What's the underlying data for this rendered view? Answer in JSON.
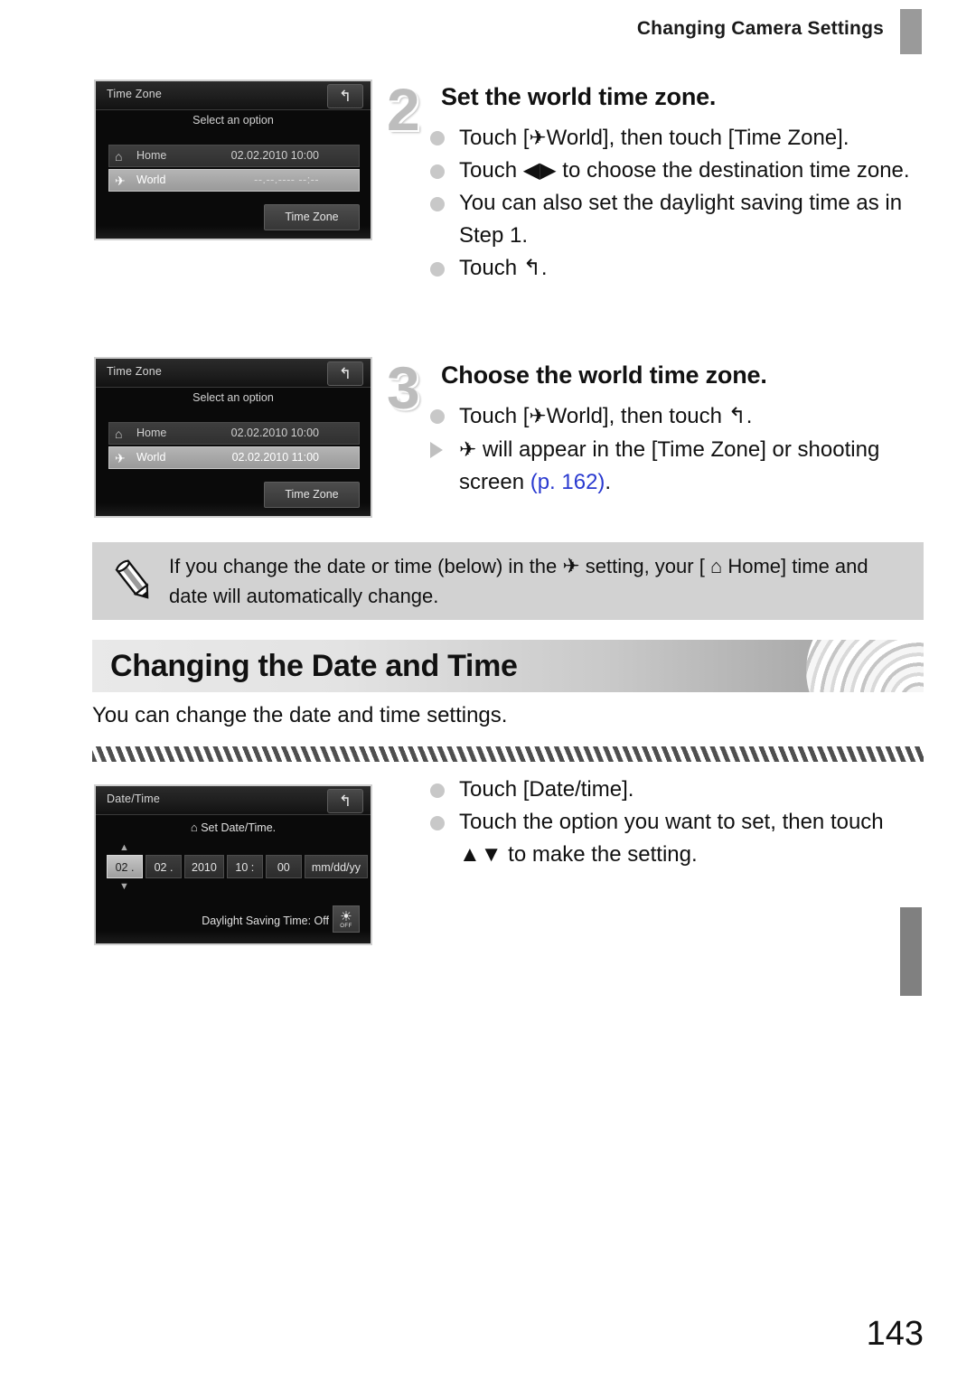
{
  "header": {
    "title": "Changing Camera Settings",
    "tab_icon": "index-tab-marker"
  },
  "screens": {
    "step2": {
      "title": "Time Zone",
      "back_icon": "↰",
      "subtitle": "Select an option",
      "rows": [
        {
          "icon": "home-icon",
          "label": "Home",
          "value": "02.02.2010 10:00",
          "selected": false
        },
        {
          "icon": "plane-icon",
          "label": "World",
          "value": "--.--.---- --:--",
          "selected": true
        }
      ],
      "button": "Time Zone"
    },
    "step3": {
      "title": "Time Zone",
      "back_icon": "↰",
      "subtitle": "Select an option",
      "rows": [
        {
          "icon": "home-icon",
          "label": "Home",
          "value": "02.02.2010 10:00",
          "selected": false
        },
        {
          "icon": "plane-icon",
          "label": "World",
          "value": "02.02.2010 11:00",
          "selected": true
        }
      ],
      "button": "Time Zone"
    },
    "datetime": {
      "title": "Date/Time",
      "back_icon": "↰",
      "caption": "Set Date/Time.",
      "fields": [
        {
          "text": "02 .",
          "active": true
        },
        {
          "text": "02 .",
          "active": false
        },
        {
          "text": "2010",
          "active": false
        },
        {
          "text": "10 :",
          "active": false
        },
        {
          "text": "00",
          "active": false
        },
        {
          "text": "mm/dd/yy",
          "active": false
        }
      ],
      "arrow_up": "▲",
      "arrow_down": "▼",
      "dst_label": "Daylight Saving Time: Off",
      "dst_button_off": "OFF"
    }
  },
  "step2": {
    "number": "2",
    "title": "Set the world time zone.",
    "items": [
      {
        "kind": "dot",
        "html": "Touch [✈ World], then touch [Time Zone]."
      },
      {
        "kind": "dot",
        "html": "Touch ◀▶ to choose the destination time zone."
      },
      {
        "kind": "dot",
        "html": "You can also set the daylight saving time as in Step 1."
      },
      {
        "kind": "dot",
        "html": "Touch ↰."
      }
    ]
  },
  "step3": {
    "number": "3",
    "title": "Choose the world time zone.",
    "items": [
      {
        "kind": "dot",
        "html": "Touch [✈ World], then touch ↰."
      },
      {
        "kind": "tri",
        "html": "✈ will appear in the [Time Zone] or shooting screen (p. 162)."
      }
    ],
    "page_ref": "(p. 162)"
  },
  "note": {
    "icon": "pencil-icon",
    "text": "If you change the date or time (below) in the ✈ setting, your [ ⌂ Home] time and date will automatically change."
  },
  "section": {
    "title": "Changing the Date and Time",
    "description": "You can change the date and time settings."
  },
  "datetime_steps": {
    "items": [
      {
        "kind": "dot",
        "html": "Touch [Date/time]."
      },
      {
        "kind": "dot",
        "html": "Touch the option you want to set, then touch ▲▼ to make the setting."
      }
    ]
  },
  "page_number": "143",
  "colors": {
    "link": "#2a3ad0",
    "note_bg": "#d2d2d2",
    "step_number": "#bdbdbd"
  }
}
